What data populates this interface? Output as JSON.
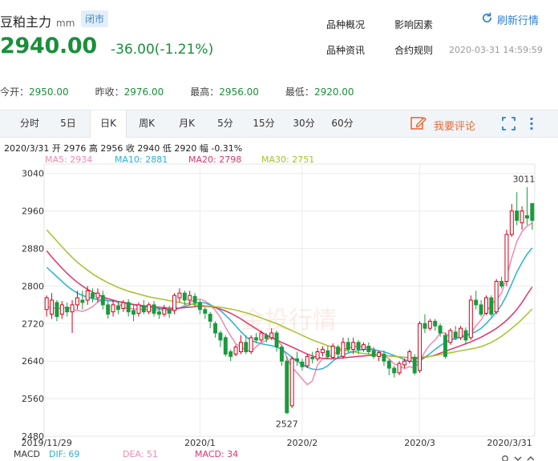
{
  "header": {
    "title": "豆粕主力",
    "unit": "mm",
    "status": "闭市",
    "price": "2940.00",
    "change": "-36.00(-1.21%)",
    "links": [
      "品种概况",
      "影响因素",
      "品种资讯",
      "合约规则"
    ],
    "refresh": "刷新行情",
    "timestamp": "2020-03-31 14:59:59",
    "price_color": "#1a8f3a"
  },
  "stats": [
    {
      "label": "今开：",
      "value": "2950.00"
    },
    {
      "label": "昨收：",
      "value": "2976.00"
    },
    {
      "label": "最高：",
      "value": "2956.00"
    },
    {
      "label": "最低：",
      "value": "2920.00"
    }
  ],
  "tabs": [
    "分时",
    "5日",
    "日K",
    "周K",
    "月K",
    "5分",
    "15分",
    "30分",
    "60分"
  ],
  "active_tab": "日K",
  "comment_button": "我要评论",
  "ohlc_line": "2020/3/31  开 2976  高 2956  收 2940  低 2920  幅 -0.31%",
  "ma_legend": [
    {
      "label": "MA5: 2934",
      "color": "#f08ab0"
    },
    {
      "label": "MA10: 2881",
      "color": "#2ab0d8"
    },
    {
      "label": "MA20: 2798",
      "color": "#e0356a"
    },
    {
      "label": "MA30: 2751",
      "color": "#a6c12a"
    }
  ],
  "macd": {
    "name": "MACD",
    "dif": "DIF: 69",
    "dea": "DEA: 51",
    "value": "MACD: 34"
  },
  "colors": {
    "up": "#d0021b",
    "down": "#1a9a3c",
    "accent": "#2f7fd1",
    "comment": "#e86a3a"
  },
  "icons": {
    "refresh": "refresh-icon",
    "comment": "edit-icon",
    "fullscreen": "fullscreen-icon",
    "more": "more-vertical-icon"
  },
  "chart_data": {
    "type": "candlestick",
    "ylim": [
      2480,
      3060
    ],
    "y_ticks": [
      3040,
      2960,
      2880,
      2800,
      2720,
      2640,
      2560,
      2480
    ],
    "x_tick_labels": [
      "2019/11/29",
      "2020/1",
      "2020/2",
      "2020/3",
      "2020/3/31"
    ],
    "annotations": [
      {
        "text": "3011",
        "kind": "max"
      },
      {
        "text": "2527",
        "kind": "min"
      }
    ],
    "watermark": "金投行情",
    "candles": [
      [
        2750,
        2775,
        2735,
        2780
      ],
      [
        2740,
        2770,
        2730,
        2785
      ],
      [
        2765,
        2735,
        2725,
        2770
      ],
      [
        2740,
        2760,
        2730,
        2768
      ],
      [
        2755,
        2745,
        2735,
        2765
      ],
      [
        2745,
        2760,
        2700,
        2770
      ],
      [
        2760,
        2775,
        2750,
        2790
      ],
      [
        2770,
        2765,
        2750,
        2790
      ],
      [
        2770,
        2790,
        2760,
        2800
      ],
      [
        2785,
        2775,
        2765,
        2795
      ],
      [
        2775,
        2785,
        2765,
        2795
      ],
      [
        2780,
        2760,
        2750,
        2790
      ],
      [
        2760,
        2740,
        2730,
        2770
      ],
      [
        2745,
        2760,
        2735,
        2770
      ],
      [
        2758,
        2750,
        2740,
        2768
      ],
      [
        2752,
        2765,
        2745,
        2770
      ],
      [
        2765,
        2745,
        2735,
        2772
      ],
      [
        2748,
        2740,
        2725,
        2760
      ],
      [
        2742,
        2760,
        2735,
        2765
      ],
      [
        2758,
        2745,
        2740,
        2770
      ],
      [
        2745,
        2760,
        2740,
        2765
      ],
      [
        2760,
        2742,
        2735,
        2768
      ],
      [
        2745,
        2740,
        2730,
        2755
      ],
      [
        2740,
        2752,
        2735,
        2760
      ],
      [
        2750,
        2742,
        2732,
        2758
      ],
      [
        2748,
        2780,
        2740,
        2785
      ],
      [
        2775,
        2785,
        2765,
        2795
      ],
      [
        2785,
        2770,
        2760,
        2790
      ],
      [
        2770,
        2780,
        2760,
        2790
      ],
      [
        2778,
        2765,
        2755,
        2785
      ],
      [
        2765,
        2750,
        2740,
        2770
      ],
      [
        2750,
        2742,
        2730,
        2755
      ],
      [
        2740,
        2725,
        2710,
        2745
      ],
      [
        2720,
        2700,
        2690,
        2725
      ],
      [
        2700,
        2685,
        2670,
        2705
      ],
      [
        2690,
        2655,
        2650,
        2695
      ],
      [
        2660,
        2650,
        2640,
        2665
      ],
      [
        2655,
        2670,
        2650,
        2675
      ],
      [
        2660,
        2680,
        2655,
        2695
      ],
      [
        2680,
        2660,
        2655,
        2695
      ],
      [
        2660,
        2690,
        2655,
        2695
      ],
      [
        2690,
        2685,
        2678,
        2700
      ],
      [
        2685,
        2700,
        2680,
        2705
      ],
      [
        2695,
        2688,
        2680,
        2700
      ],
      [
        2690,
        2700,
        2685,
        2710
      ],
      [
        2700,
        2670,
        2660,
        2705
      ],
      [
        2670,
        2640,
        2630,
        2675
      ],
      [
        2640,
        2530,
        2527,
        2650
      ],
      [
        2545,
        2645,
        2540,
        2650
      ],
      [
        2645,
        2640,
        2630,
        2660
      ],
      [
        2638,
        2628,
        2620,
        2645
      ],
      [
        2630,
        2650,
        2625,
        2655
      ],
      [
        2648,
        2645,
        2635,
        2660
      ],
      [
        2645,
        2660,
        2640,
        2668
      ],
      [
        2658,
        2665,
        2650,
        2672
      ],
      [
        2662,
        2650,
        2645,
        2672
      ],
      [
        2648,
        2672,
        2645,
        2678
      ],
      [
        2670,
        2655,
        2645,
        2675
      ],
      [
        2650,
        2680,
        2645,
        2690
      ],
      [
        2680,
        2665,
        2658,
        2690
      ],
      [
        2665,
        2680,
        2655,
        2690
      ],
      [
        2680,
        2665,
        2655,
        2685
      ],
      [
        2665,
        2675,
        2660,
        2680
      ],
      [
        2672,
        2660,
        2655,
        2680
      ],
      [
        2662,
        2650,
        2645,
        2670
      ],
      [
        2650,
        2658,
        2640,
        2662
      ],
      [
        2655,
        2640,
        2630,
        2662
      ],
      [
        2640,
        2625,
        2610,
        2645
      ],
      [
        2625,
        2615,
        2605,
        2630
      ],
      [
        2615,
        2635,
        2610,
        2640
      ],
      [
        2632,
        2640,
        2625,
        2645
      ],
      [
        2640,
        2660,
        2635,
        2665
      ],
      [
        2648,
        2615,
        2610,
        2655
      ],
      [
        2620,
        2720,
        2615,
        2725
      ],
      [
        2720,
        2710,
        2700,
        2740
      ],
      [
        2710,
        2725,
        2705,
        2730
      ],
      [
        2725,
        2715,
        2705,
        2730
      ],
      [
        2715,
        2700,
        2692,
        2720
      ],
      [
        2695,
        2650,
        2645,
        2700
      ],
      [
        2680,
        2705,
        2675,
        2710
      ],
      [
        2702,
        2690,
        2685,
        2715
      ],
      [
        2690,
        2710,
        2685,
        2715
      ],
      [
        2705,
        2685,
        2675,
        2712
      ],
      [
        2690,
        2770,
        2685,
        2780
      ],
      [
        2770,
        2760,
        2750,
        2790
      ],
      [
        2760,
        2740,
        2735,
        2770
      ],
      [
        2742,
        2775,
        2738,
        2780
      ],
      [
        2775,
        2740,
        2735,
        2780
      ],
      [
        2745,
        2810,
        2740,
        2815
      ],
      [
        2810,
        2800,
        2795,
        2820
      ],
      [
        2810,
        2910,
        2800,
        2920
      ],
      [
        2910,
        2960,
        2905,
        2975
      ],
      [
        2960,
        2940,
        2930,
        3000
      ],
      [
        2935,
        2960,
        2920,
        2970
      ],
      [
        2950,
        2945,
        2930,
        3011
      ],
      [
        2976,
        2940,
        2920,
        2956
      ]
    ],
    "ma": [
      {
        "name": "MA5",
        "color": "#f08ab0",
        "values": [
          2755,
          2754,
          2752,
          2753,
          2755,
          2750,
          2748,
          2746,
          2750,
          2756,
          2766,
          2770,
          2773,
          2770,
          2764,
          2755,
          2752,
          2752,
          2750,
          2750,
          2750,
          2748,
          2750,
          2749,
          2748,
          2748,
          2753,
          2759,
          2765,
          2771,
          2772,
          2768,
          2761,
          2748,
          2733,
          2712,
          2694,
          2677,
          2670,
          2664,
          2660,
          2671,
          2679,
          2684,
          2691,
          2686,
          2673,
          2648,
          2626,
          2615,
          2602,
          2590,
          2598,
          2632,
          2645,
          2648,
          2655,
          2660,
          2665,
          2668,
          2670,
          2672,
          2670,
          2668,
          2666,
          2660,
          2653,
          2645,
          2634,
          2630,
          2624,
          2628,
          2625,
          2640,
          2660,
          2675,
          2685,
          2700,
          2700,
          2690,
          2686,
          2694,
          2695,
          2700,
          2715,
          2728,
          2745,
          2760,
          2772,
          2785,
          2820,
          2860,
          2895,
          2916,
          2928,
          2934
        ]
      },
      {
        "name": "MA10",
        "color": "#2ab0d8",
        "values": [
          2840,
          2830,
          2820,
          2810,
          2800,
          2792,
          2785,
          2780,
          2776,
          2773,
          2771,
          2770,
          2769,
          2768,
          2767,
          2765,
          2762,
          2760,
          2758,
          2756,
          2755,
          2754,
          2752,
          2751,
          2750,
          2751,
          2753,
          2756,
          2760,
          2763,
          2765,
          2764,
          2760,
          2755,
          2748,
          2738,
          2727,
          2715,
          2703,
          2692,
          2684,
          2680,
          2677,
          2675,
          2673,
          2670,
          2665,
          2657,
          2648,
          2640,
          2633,
          2627,
          2623,
          2622,
          2624,
          2630,
          2640,
          2648,
          2653,
          2657,
          2660,
          2663,
          2665,
          2665,
          2664,
          2662,
          2660,
          2656,
          2652,
          2648,
          2643,
          2640,
          2638,
          2640,
          2648,
          2656,
          2665,
          2673,
          2680,
          2685,
          2688,
          2691,
          2694,
          2698,
          2703,
          2710,
          2720,
          2732,
          2745,
          2760,
          2780,
          2805,
          2830,
          2850,
          2868,
          2881
        ]
      },
      {
        "name": "MA20",
        "color": "#e0356a",
        "values": [
          2875,
          2862,
          2850,
          2838,
          2827,
          2817,
          2808,
          2800,
          2793,
          2787,
          2782,
          2777,
          2773,
          2770,
          2767,
          2765,
          2763,
          2761,
          2759,
          2758,
          2757,
          2756,
          2755,
          2754,
          2753,
          2753,
          2753,
          2754,
          2755,
          2756,
          2757,
          2757,
          2756,
          2754,
          2751,
          2747,
          2742,
          2736,
          2730,
          2723,
          2716,
          2709,
          2702,
          2696,
          2690,
          2685,
          2680,
          2675,
          2670,
          2665,
          2660,
          2655,
          2651,
          2648,
          2646,
          2645,
          2645,
          2646,
          2647,
          2648,
          2649,
          2650,
          2651,
          2652,
          2653,
          2653,
          2652,
          2651,
          2650,
          2649,
          2648,
          2647,
          2646,
          2646,
          2648,
          2650,
          2653,
          2657,
          2661,
          2665,
          2669,
          2673,
          2677,
          2681,
          2686,
          2691,
          2697,
          2703,
          2710,
          2718,
          2727,
          2738,
          2750,
          2765,
          2782,
          2798
        ]
      },
      {
        "name": "MA30",
        "color": "#a6c12a",
        "values": [
          2920,
          2908,
          2896,
          2884,
          2872,
          2861,
          2851,
          2842,
          2834,
          2826,
          2819,
          2813,
          2807,
          2802,
          2797,
          2793,
          2789,
          2786,
          2783,
          2780,
          2777,
          2775,
          2773,
          2771,
          2769,
          2767,
          2765,
          2763,
          2762,
          2760,
          2759,
          2758,
          2757,
          2756,
          2755,
          2753,
          2751,
          2749,
          2746,
          2743,
          2740,
          2736,
          2732,
          2728,
          2724,
          2720,
          2715,
          2710,
          2705,
          2700,
          2695,
          2690,
          2685,
          2681,
          2677,
          2673,
          2670,
          2667,
          2664,
          2662,
          2660,
          2658,
          2656,
          2655,
          2654,
          2653,
          2652,
          2651,
          2650,
          2649,
          2648,
          2648,
          2648,
          2648,
          2649,
          2650,
          2652,
          2654,
          2656,
          2658,
          2660,
          2662,
          2664,
          2666,
          2668,
          2671,
          2675,
          2680,
          2686,
          2693,
          2701,
          2710,
          2719,
          2729,
          2740,
          2751
        ]
      }
    ]
  }
}
